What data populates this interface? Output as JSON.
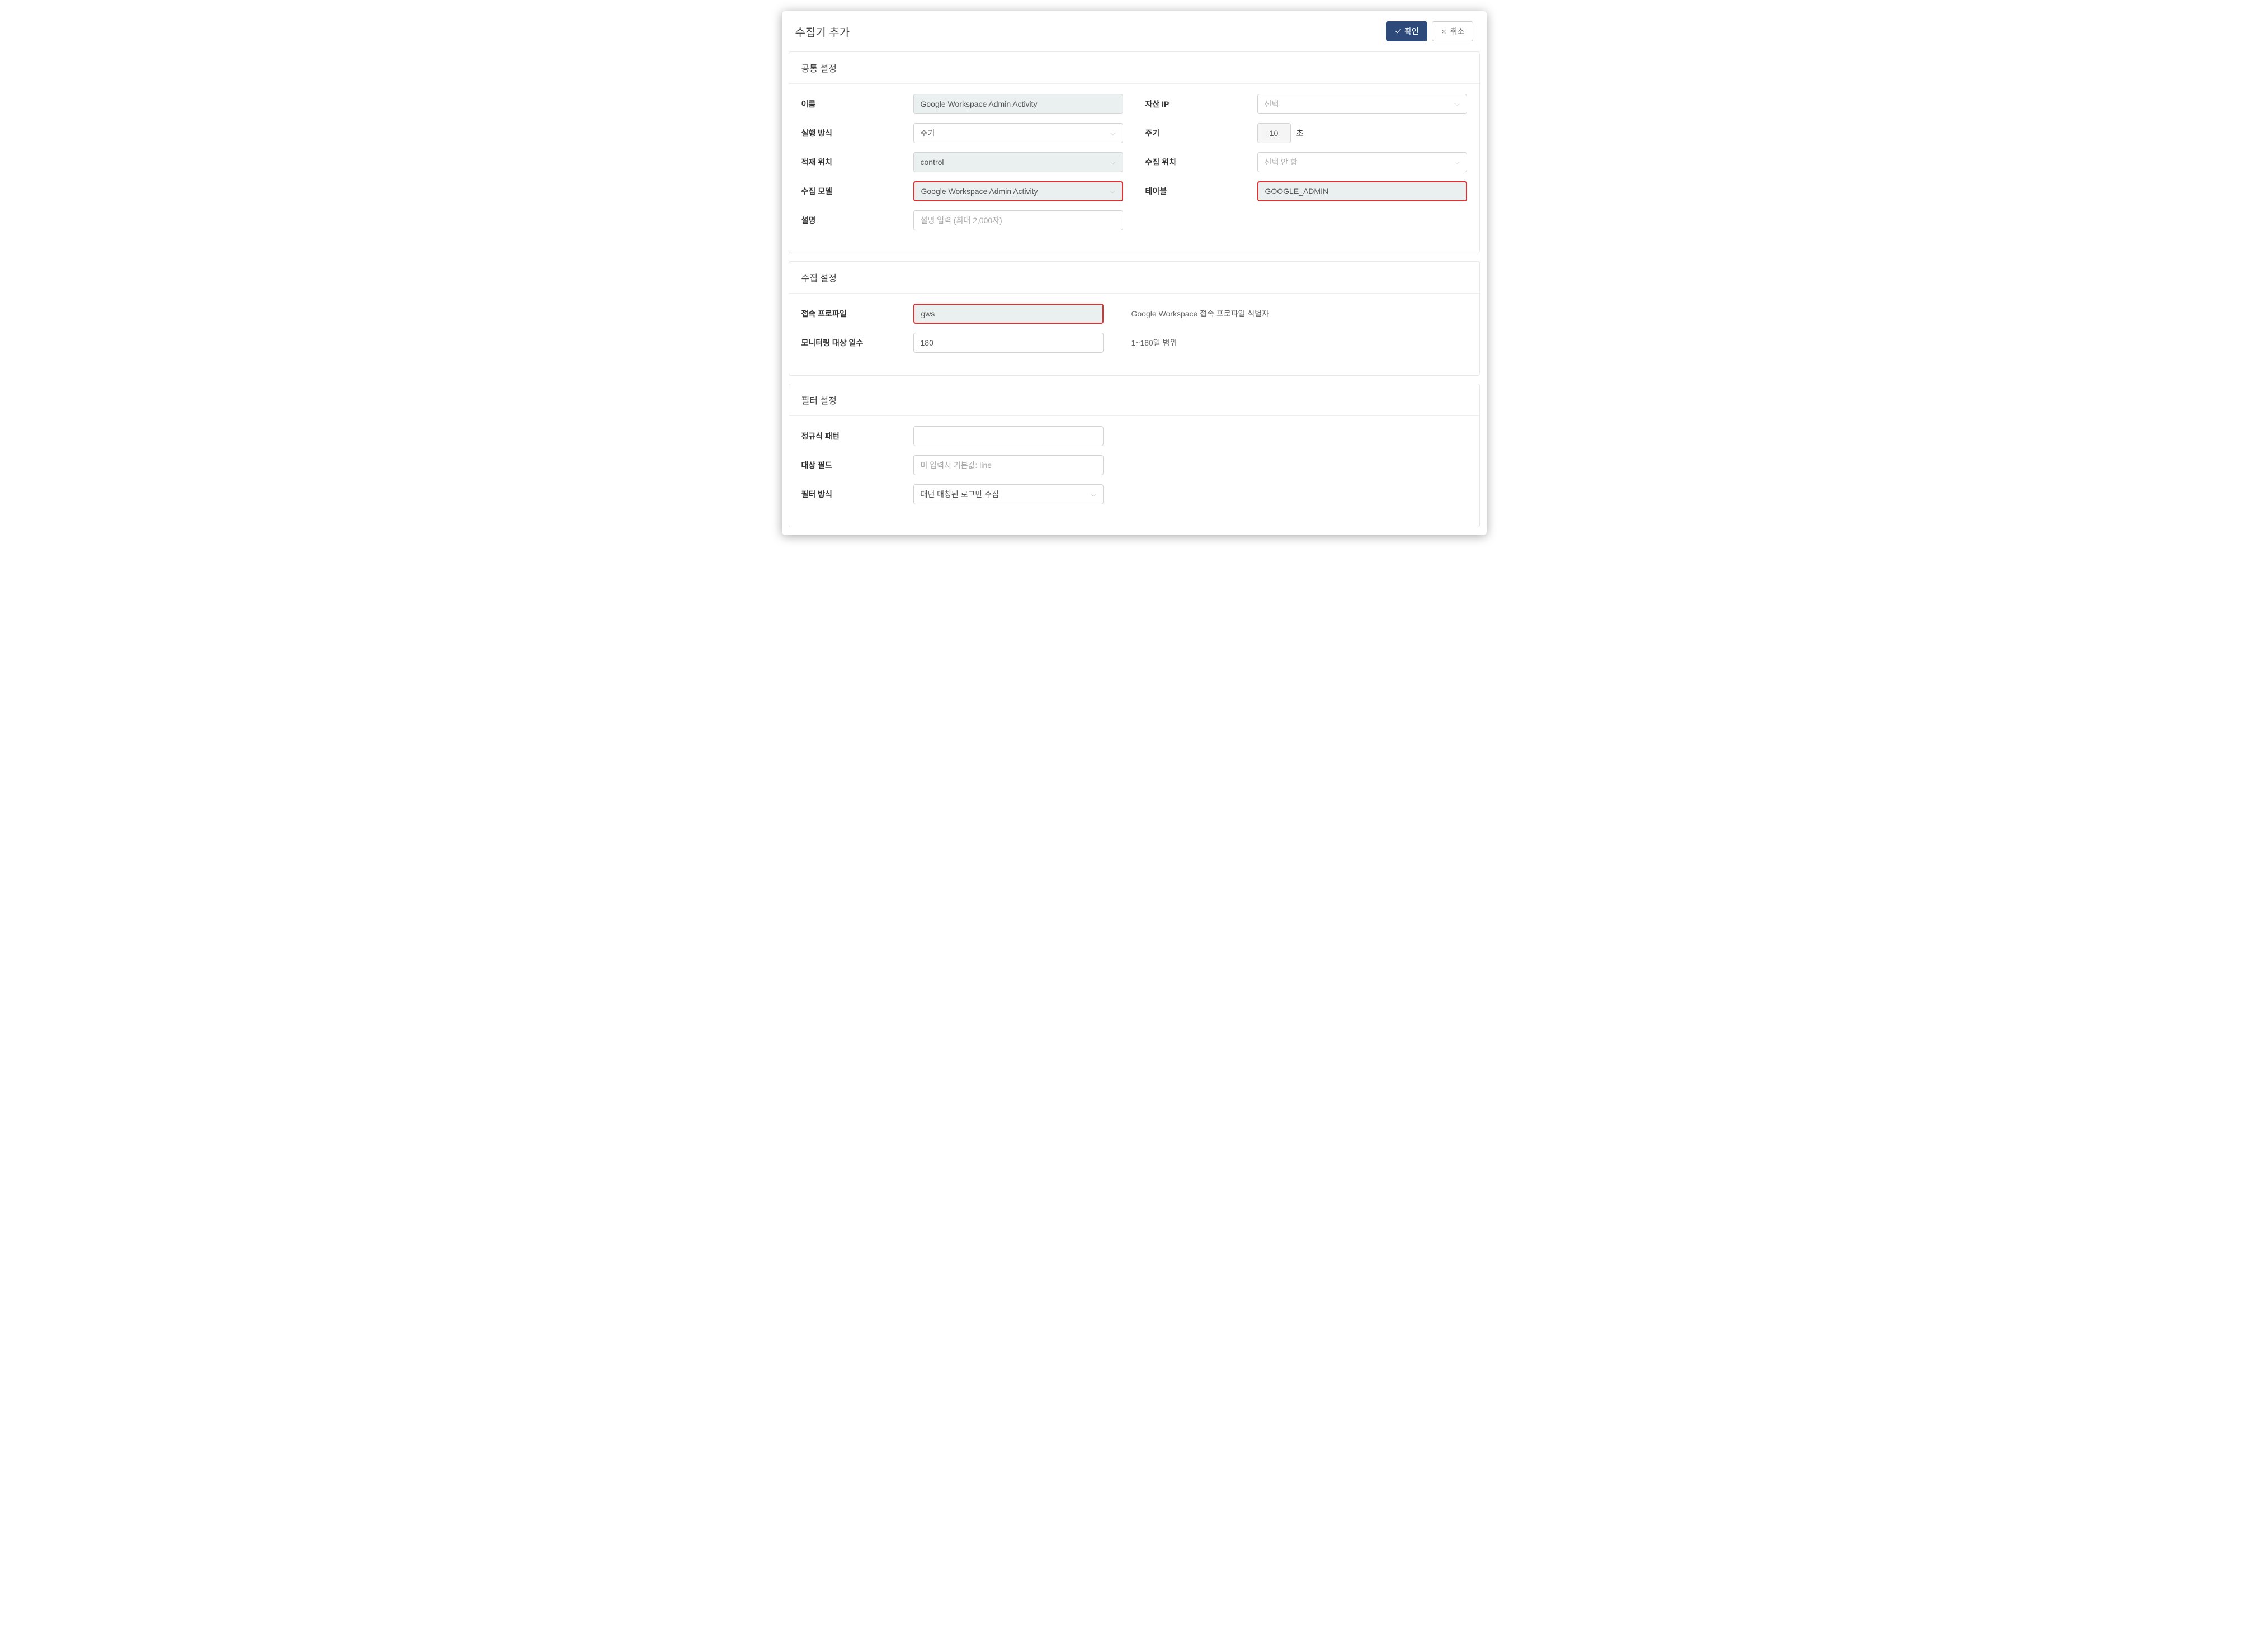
{
  "header": {
    "title": "수집기 추가",
    "confirm": "확인",
    "cancel": "취소"
  },
  "common": {
    "title": "공통 설정",
    "name_label": "이름",
    "name_value": "Google Workspace Admin Activity",
    "asset_ip_label": "자산 IP",
    "asset_ip_placeholder": "선택",
    "exec_method_label": "실행 방식",
    "exec_method_value": "주기",
    "interval_label": "주기",
    "interval_value": "10",
    "interval_unit": "초",
    "storage_label": "적재 위치",
    "storage_value": "control",
    "collect_loc_label": "수집 위치",
    "collect_loc_placeholder": "선택 안 함",
    "collect_model_label": "수집 모델",
    "collect_model_value": "Google Workspace Admin Activity",
    "table_label": "테이블",
    "table_value": "GOOGLE_ADMIN",
    "desc_label": "설명",
    "desc_placeholder": "설명 입력 (최대 2,000자)"
  },
  "collect": {
    "title": "수집 설정",
    "profile_label": "접속 프로파일",
    "profile_value": "gws",
    "profile_help": "Google Workspace 접속 프로파일 식별자",
    "monitor_days_label": "모니터링 대상 일수",
    "monitor_days_value": "180",
    "monitor_days_help": "1~180일 범위"
  },
  "filter": {
    "title": "필터 설정",
    "regex_label": "정규식 패턴",
    "target_field_label": "대상 필드",
    "target_field_placeholder": "미 입력시 기본값: line",
    "filter_method_label": "필터 방식",
    "filter_method_value": "패턴 매칭된 로그만 수집"
  }
}
